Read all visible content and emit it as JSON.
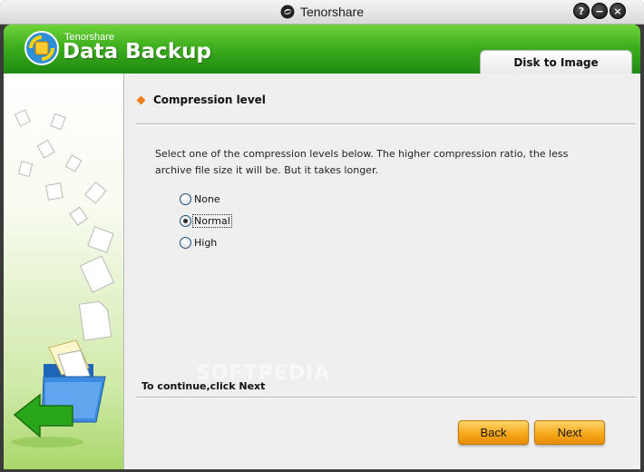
{
  "window": {
    "title": "Tenorshare",
    "buttons": {
      "help": "?",
      "minimize": "−",
      "close": "×"
    }
  },
  "header": {
    "brand_small": "Tenorshare",
    "brand_big": "Data Backup",
    "tab_label": "Disk to Image"
  },
  "section": {
    "title": "Compression level",
    "description": "Select one of the compression levels below. The higher compression ratio, the less archive file size it will be. But it takes longer."
  },
  "options": [
    {
      "label": "None",
      "checked": false
    },
    {
      "label": "Normal",
      "checked": true
    },
    {
      "label": "High",
      "checked": false
    }
  ],
  "footer": {
    "continue_text": "To continue,click Next",
    "back_label": "Back",
    "next_label": "Next"
  },
  "watermark": "SOFTPEDIA",
  "colors": {
    "header_green": "#3fae1e",
    "bullet_orange": "#f07f1a",
    "button_orange": "#f7a81c"
  }
}
